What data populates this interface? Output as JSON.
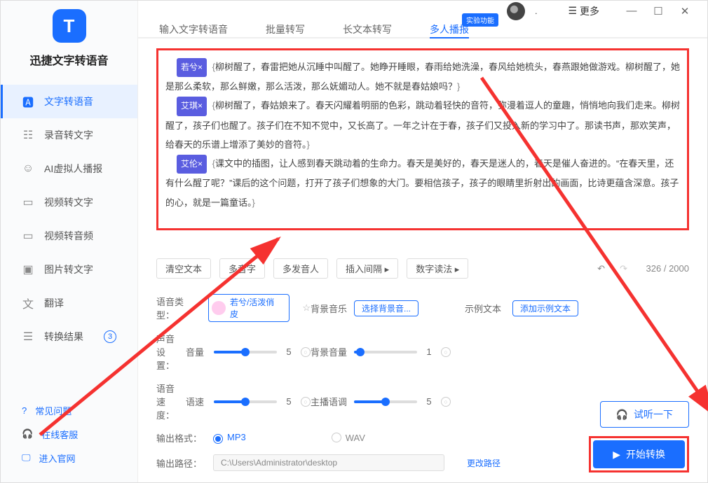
{
  "app": {
    "title": "迅捷文字转语音"
  },
  "titlebar": {
    "user": ".",
    "more": "更多"
  },
  "sidebar": {
    "items": [
      {
        "label": "文字转语音"
      },
      {
        "label": "录音转文字"
      },
      {
        "label": "AI虚拟人播报"
      },
      {
        "label": "视频转文字"
      },
      {
        "label": "视频转音频"
      },
      {
        "label": "图片转文字"
      },
      {
        "label": "翻译"
      },
      {
        "label": "转换结果",
        "badge": "3"
      }
    ],
    "bottom": [
      {
        "label": "常见问题"
      },
      {
        "label": "在线客服"
      },
      {
        "label": "进入官网"
      }
    ]
  },
  "tabs": {
    "items": [
      {
        "label": "输入文字转语音"
      },
      {
        "label": "批量转写"
      },
      {
        "label": "长文本转写"
      },
      {
        "label": "多人播报",
        "badge": "实验功能"
      }
    ]
  },
  "editor": {
    "speakers": [
      "若兮",
      "艾琪",
      "艾伦"
    ],
    "texts": [
      "柳树醒了，春雷把她从沉睡中叫醒了。她睁开睡眼，春雨给她洗澡，春风给她梳头，春燕跟她做游戏。柳树醒了，她是那么柔软，那么鲜嫩，那么活泼，那么妩媚动人。她不就是春姑娘吗？",
      "柳树醒了，春姑娘来了。春天闪耀着明丽的色彩，跳动着轻快的音符，弥漫着逗人的童趣，悄悄地向我们走来。柳树醒了，孩子们也醒了。孩子们在不知不觉中，又长高了。一年之计在于春，孩子们又投入新的学习中了。那读书声，那欢笑声，给春天的乐谱上增添了美妙的音符。",
      "课文中的插图，让人感到春天跳动着的生命力。春天是美好的，春天是迷人的，春天是催人奋进的。“在春天里，还有什么醒了呢？”课后的这个问题，打开了孩子们想象的大门。要相信孩子，孩子的眼睛里折射出的画面，比诗更蕴含深意。孩子的心，就是一篇童话。"
    ]
  },
  "toolbar": {
    "clear": "清空文本",
    "polyphone": "多音字",
    "multi_speaker": "多发音人",
    "insert_pause": "插入间隔 ▸",
    "number_read": "数字读法 ▸",
    "count_current": "326",
    "count_max": "2000"
  },
  "settings": {
    "voice_type_label": "语音类型：",
    "voice_name": "若兮/活泼俏皮",
    "bg_music_label": "背景音乐",
    "bg_select": "选择背景音...",
    "sample_label": "示例文本",
    "sample_btn": "添加示例文本",
    "sound_label": "声音设置：",
    "volume_label": "音量",
    "volume_val": "5",
    "bg_vol_label": "背景音量",
    "bg_vol_val": "1",
    "speed_label": "语音速度：",
    "speed_sub": "语速",
    "speed_val": "5",
    "tone_label": "主播语调",
    "tone_val": "5",
    "format_label": "输出格式：",
    "fmt_mp3": "MP3",
    "fmt_wav": "WAV",
    "path_label": "输出路径：",
    "path_value": "C:\\Users\\Administrator\\desktop",
    "change_path": "更改路径"
  },
  "actions": {
    "preview": "试听一下",
    "start": "开始转换"
  }
}
